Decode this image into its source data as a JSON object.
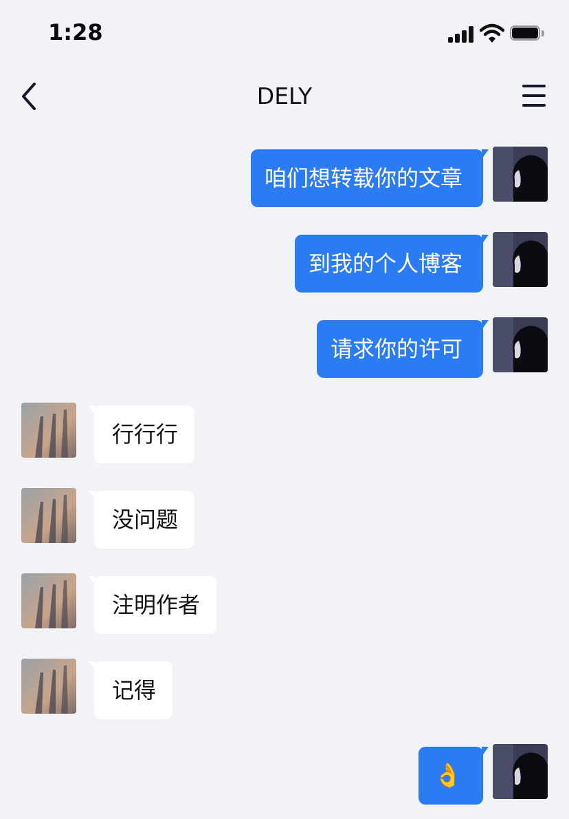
{
  "status_bar": {
    "time": "1:28"
  },
  "nav": {
    "title": "DELY"
  },
  "messages": [
    {
      "side": "out",
      "text": "咱们想转载你的文章"
    },
    {
      "side": "out",
      "text": "到我的个人博客"
    },
    {
      "side": "out",
      "text": "请求你的许可"
    },
    {
      "side": "in",
      "text": "行行行"
    },
    {
      "side": "in",
      "text": "没问题"
    },
    {
      "side": "in",
      "text": "注明作者"
    },
    {
      "side": "in",
      "text": "记得"
    },
    {
      "side": "out",
      "text": "👌"
    }
  ],
  "colors": {
    "background": "#f2f3f7",
    "outgoing_bubble": "#2b7bf2",
    "incoming_bubble": "#ffffff"
  }
}
